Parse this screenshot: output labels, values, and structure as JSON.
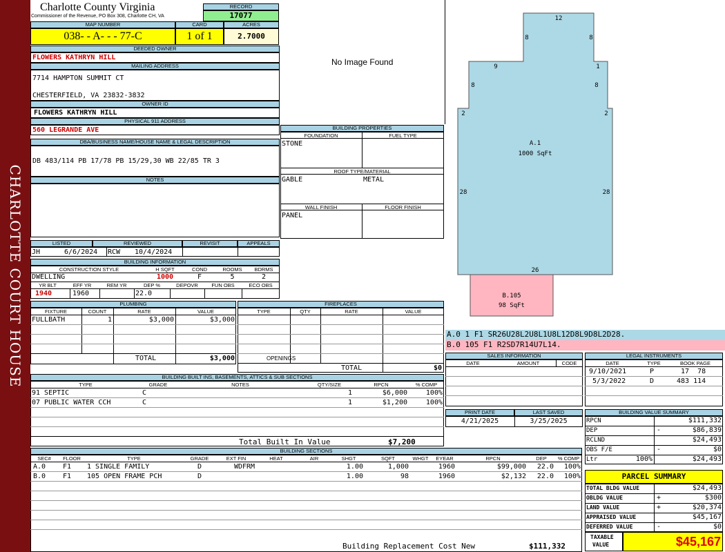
{
  "sidebar": {
    "title": "CHARLOTTE COURT HOUSE"
  },
  "header": {
    "county": "Charlotte County Virginia",
    "address": "Commissioner of the Revenue, PO Box 308, Charlotte CH, VA",
    "record_label": "RECORD",
    "record": "17077",
    "map_label": "MAP NUMBER",
    "map_number": "038- - A- - - 77-C",
    "card_label": "CARD",
    "card": "1 of 1",
    "acres_label": "ACRES",
    "acres": "2.7000"
  },
  "owner": {
    "deeded_label": "DEEDED OWNER",
    "deeded": "FLOWERS KATHRYN HILL",
    "mailing_label": "MAILING ADDRESS",
    "mail_line1": "7714 HAMPTON SUMMIT CT",
    "mail_line2": "CHESTERFIELD, VA 23832-3832",
    "owner_id_label": "OWNER ID",
    "owner_id": "FLOWERS KATHRYN HILL",
    "phys_label": "PHYSICAL 911 ADDRESS",
    "phys": "560 LEGRANDE AVE",
    "dba_label": "DBA/BUSINESS NAME/HOUSE NAME & LEGAL DESCRIPTION",
    "legal": "DB 483/114 PB 17/78 PB 15/29,30 WB 22/85 TR 3",
    "notes_label": "NOTES"
  },
  "image": {
    "placeholder": "No Image Found"
  },
  "bprops": {
    "title": "BUILDING PROPERTIES",
    "foundation_label": "FOUNDATION",
    "fuel_label": "FUEL TYPE",
    "foundation": "STONE",
    "roof_label": "ROOF TYPE/MATERIAL",
    "roof_type": "GABLE",
    "roof_material": "METAL",
    "wall_label": "WALL FINISH",
    "floor_label": "FLOOR FINISH",
    "wall": "PANEL"
  },
  "listing": {
    "listed_label": "LISTED",
    "reviewed_label": "REVIEWED",
    "revisit_label": "REVISIT",
    "appeals_label": "APPEALS",
    "listed_by": "JH",
    "listed_date": "6/6/2024",
    "reviewed_by": "RCW",
    "reviewed_date": "10/4/2024"
  },
  "binfo": {
    "title": "BUILDING INFORMATION",
    "cs_label": "CONSTRUCTION STYLE",
    "hsqft_label": "H SQFT",
    "cond_label": "COND",
    "rooms_label": "ROOMS",
    "bdrms_label": "BDRMS",
    "style": "DWELLING",
    "hsqft": "1000",
    "cond": "F",
    "rooms": "5",
    "bdrms": "2",
    "yrblt_label": "YR BLT",
    "effyr_label": "EFF YR",
    "remyr_label": "REM YR",
    "dep_label": "DEP %",
    "depovr_label": "DEPOVR",
    "funobs_label": "FUN OBS",
    "ecoobs_label": "ECO OBS",
    "yrblt": "1940",
    "effyr": "1960",
    "dep": "22.0"
  },
  "plumbing": {
    "title": "PLUMBING",
    "h_fixture": "FIXTURE",
    "h_count": "COUNT",
    "h_rate": "RATE",
    "h_value": "VALUE",
    "rows": [
      {
        "fixture": "FULLBATH",
        "count": "1",
        "rate": "$3,000",
        "value": "$3,000"
      }
    ],
    "total_label": "TOTAL",
    "total": "$3,000"
  },
  "fireplaces": {
    "title": "FIREPLACES",
    "h_type": "TYPE",
    "h_qty": "QTY",
    "h_rate": "RATE",
    "h_value": "VALUE",
    "openings_label": "OPENINGS",
    "total_label": "TOTAL",
    "total": "$0"
  },
  "sketch": {
    "main_label": "A.1",
    "main_area": "1000 SqFt",
    "porch_label": "B.105",
    "porch_area": "98 SqFt",
    "dims": {
      "top": "12",
      "ul": "8",
      "ur": "8",
      "l2": "9",
      "r2": "1",
      "l3": "8",
      "r3": "8",
      "l4": "2",
      "r4": "2",
      "l5": "28",
      "r5": "28",
      "bottom": "26"
    },
    "codes": [
      "A.0  1   F1  SR26U28L2U8L1U8L12D8L9D8L2D28.",
      "B.0  105  F1  R2SD7R14U7L14."
    ]
  },
  "builtins": {
    "title": "BUILDING BUILT INS, BASEMENTS, ATTICS & SUB SECTIONS",
    "h_type": "TYPE",
    "h_grade": "GRADE",
    "h_notes": "NOTES",
    "h_qty": "QTY/SIZE",
    "h_rpcn": "RPCN",
    "h_comp": "% COMP",
    "rows": [
      {
        "type": "91 SEPTIC",
        "grade": "C",
        "qty": "1",
        "rpcn": "$6,000",
        "comp": "100%"
      },
      {
        "type": "07 PUBLIC WATER CCH",
        "grade": "C",
        "qty": "1",
        "rpcn": "$1,200",
        "comp": "100%"
      }
    ],
    "total_label": "Total Built In Value",
    "total": "$7,200"
  },
  "sales": {
    "title": "SALES INFORMATION",
    "h_date": "DATE",
    "h_amount": "AMOUNT",
    "h_code": "CODE"
  },
  "legal": {
    "title": "LEGAL INSTRUMENTS",
    "h_date": "DATE",
    "h_type": "TYPE",
    "h_book": "BOOK PAGE",
    "rows": [
      {
        "date": "9/10/2021",
        "type": "P",
        "book": "17  78"
      },
      {
        "date": "5/3/2022",
        "type": "D",
        "book": "483 114"
      }
    ]
  },
  "dates": {
    "print_label": "PRINT DATE",
    "saved_label": "LAST SAVED",
    "print": "4/21/2025",
    "saved": "3/25/2025"
  },
  "bvs": {
    "title": "BUILDING VALUE SUMMARY",
    "rpcn_label": "RPCN",
    "rpcn": "$111,332",
    "dep_label": "DEP",
    "dep_sign": "-",
    "dep": "$86,839",
    "rclnd_label": "RCLND",
    "rclnd": "$24,493",
    "obs_label": "OBS F/E",
    "obs_sign": "-",
    "obs": "$0",
    "ltr_label": "Ltr",
    "ltr_pct": "100%",
    "ltr": "$24,493"
  },
  "parcel": {
    "title": "PARCEL SUMMARY",
    "tbv_label": "TOTAL BLDG VALUE",
    "tbv": "$24,493",
    "obldg_label": "OBLDG VALUE",
    "obldg_sign": "+",
    "obldg": "$300",
    "land_label": "LAND VALUE",
    "land_sign": "+",
    "land": "$20,374",
    "appr_label": "APPRAISED VALUE",
    "appr": "$45,167",
    "def_label": "DEFERRED VALUE",
    "def_sign": "-",
    "def": "$0",
    "taxable_label1": "TAXABLE",
    "taxable_label2": "VALUE",
    "taxable": "$45,167"
  },
  "sections": {
    "title": "BUILDING SECTIONS",
    "h_sec": "SEC#",
    "h_floor": "FLOOR",
    "h_type": "TYPE",
    "h_grade": "GRADE",
    "h_extfin": "EXT FIN",
    "h_heat": "HEAT",
    "h_air": "AIR",
    "h_shgt": "SHGT",
    "h_sqft": "SQFT",
    "h_whgt": "WHGT",
    "h_eyear": "EYEAR",
    "h_rpcn": "RPCN",
    "h_dep": "DEP",
    "h_comp": "% COMP",
    "rows": [
      {
        "sec": "A.0",
        "floor": "F1",
        "type": "1 SINGLE FAMILY",
        "grade": "D",
        "extfin": "WDFRM",
        "shgt": "1.00",
        "sqft": "1,000",
        "eyear": "1960",
        "rpcn": "$99,000",
        "dep": "22.0",
        "comp": "100%"
      },
      {
        "sec": "B.0",
        "floor": "F1",
        "type": "105 OPEN FRAME PCH",
        "grade": "D",
        "extfin": "",
        "shgt": "1.00",
        "sqft": "98",
        "eyear": "1960",
        "rpcn": "$2,132",
        "dep": "22.0",
        "comp": "100%"
      }
    ],
    "brcn_label": "Building Replacement Cost New",
    "brcn": "$111,332"
  }
}
